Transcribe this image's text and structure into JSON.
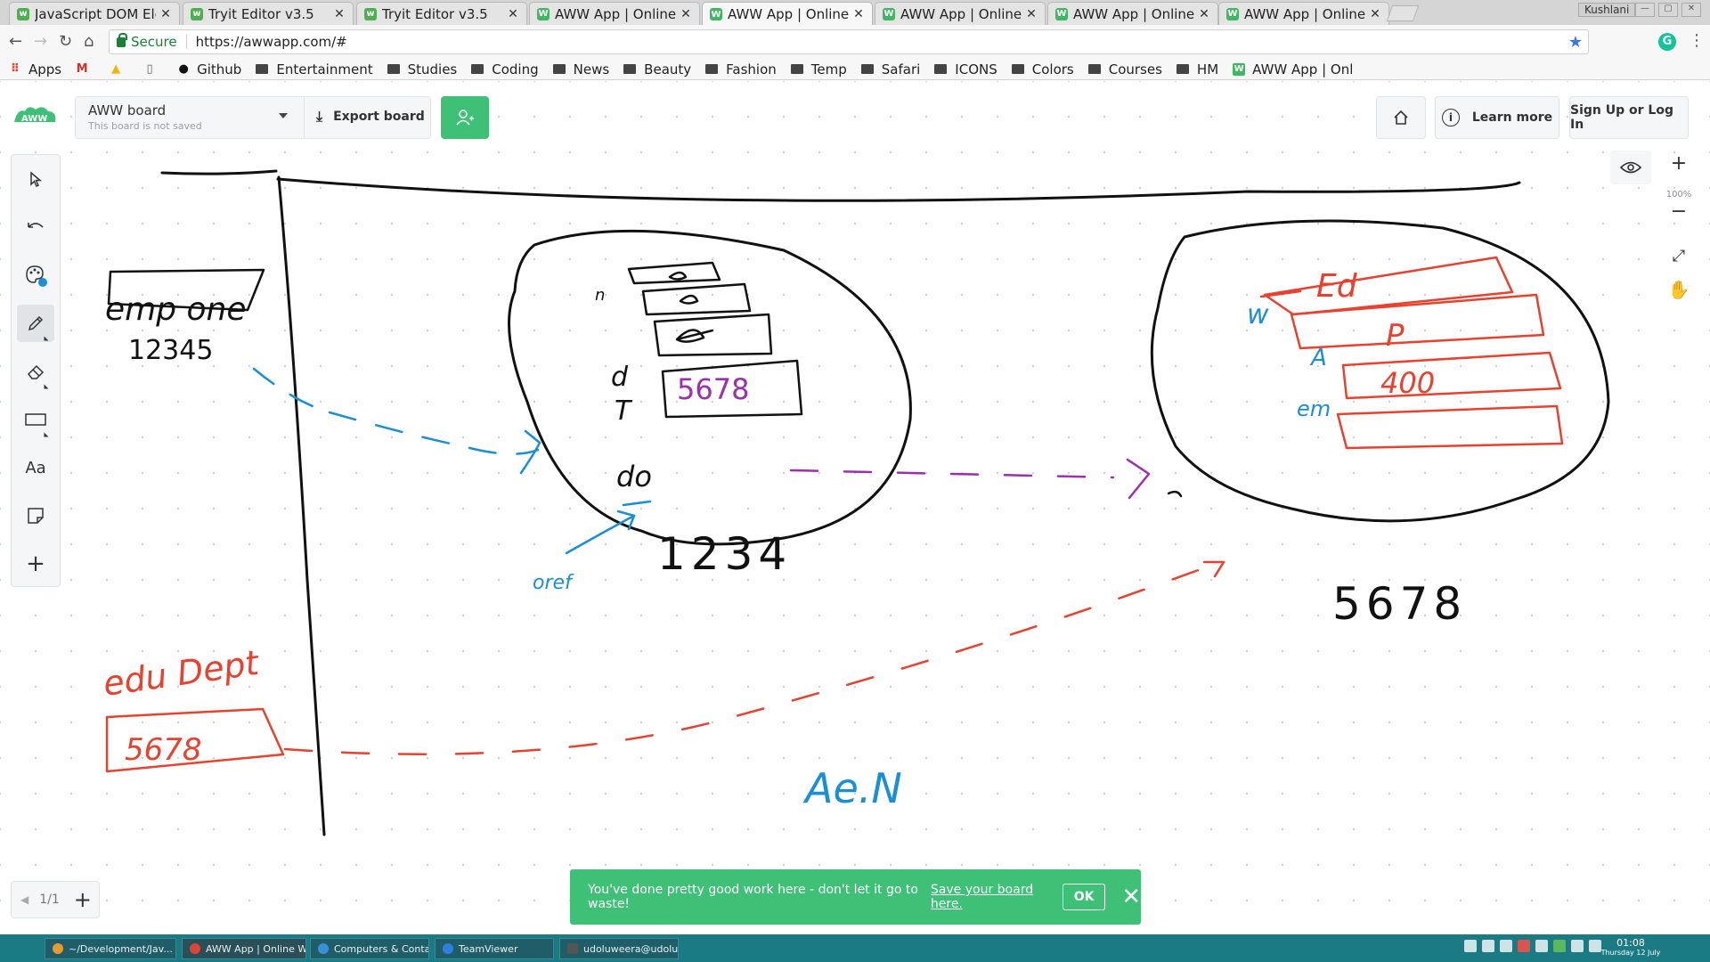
{
  "browser": {
    "tabs": [
      {
        "title": "JavaScript DOM Ele",
        "favicon": "w3-icon",
        "active": false
      },
      {
        "title": "Tryit Editor v3.5",
        "favicon": "w3-icon",
        "active": false
      },
      {
        "title": "Tryit Editor v3.5",
        "favicon": "w3-icon",
        "active": false
      },
      {
        "title": "AWW App | Online",
        "favicon": "aww-icon",
        "active": false
      },
      {
        "title": "AWW App | Online",
        "favicon": "aww-icon",
        "active": true
      },
      {
        "title": "AWW App | Online",
        "favicon": "aww-icon",
        "active": false
      },
      {
        "title": "AWW App | Online",
        "favicon": "aww-icon",
        "active": false
      },
      {
        "title": "AWW App | Online",
        "favicon": "aww-icon",
        "active": false
      }
    ],
    "window_user": "Kushlani",
    "secure_label": "Secure",
    "url": "https://awwapp.com/#",
    "bookmarks": [
      {
        "label": "Apps",
        "icon": "apps-grid-icon"
      },
      {
        "label": "",
        "icon": "gmail-icon"
      },
      {
        "label": "",
        "icon": "drive-icon"
      },
      {
        "label": "",
        "icon": "page-icon"
      },
      {
        "label": "Github",
        "icon": "github-icon"
      },
      {
        "label": "Entertainment",
        "icon": "folder-icon"
      },
      {
        "label": "Studies",
        "icon": "folder-icon"
      },
      {
        "label": "Coding",
        "icon": "folder-icon"
      },
      {
        "label": "News",
        "icon": "folder-icon"
      },
      {
        "label": "Beauty",
        "icon": "folder-icon"
      },
      {
        "label": "Fashion",
        "icon": "folder-icon"
      },
      {
        "label": "Temp",
        "icon": "folder-icon"
      },
      {
        "label": "Safari",
        "icon": "folder-icon"
      },
      {
        "label": "ICONS",
        "icon": "folder-icon"
      },
      {
        "label": "Colors",
        "icon": "folder-icon"
      },
      {
        "label": "Courses",
        "icon": "folder-icon"
      },
      {
        "label": "HM",
        "icon": "folder-icon"
      },
      {
        "label": "AWW App | Onl",
        "icon": "aww-icon"
      }
    ]
  },
  "app": {
    "logo_text": "AWW",
    "board_name": "AWW board",
    "board_status": "This board is not saved",
    "export_label": "Export board",
    "learn_more_label": "Learn more",
    "signup_label": "Sign Up or Log In",
    "zoom_level": "100%",
    "page_counter": "1/1",
    "tools": [
      "select-tool",
      "undo",
      "color-palette",
      "pencil",
      "eraser",
      "rectangle",
      "text",
      "sticky-note",
      "add"
    ],
    "text_tool_label": "Aa",
    "colors": {
      "accent": "#3ec076",
      "ink_black": "#111111",
      "ink_blue": "#1a8fd6",
      "ink_red": "#e8412e",
      "ink_purple": "#9b2fae"
    }
  },
  "canvas_text": {
    "emp_label": "emp one",
    "emp_box": "12345",
    "edu_label": "edu Dept",
    "edu_box": "5678",
    "obj1_box": "5678",
    "obj1_label": "1234",
    "obj2_label": "5678",
    "obj2_box1": "Ed",
    "obj2_box2": "P",
    "obj2_box3": "400",
    "obj2_letter1": "w",
    "obj2_letter2": "A",
    "obj2_letter3": "em",
    "props": [
      "n",
      "d",
      "T",
      "do"
    ],
    "oref_label": "oref",
    "note": "Ae.N"
  },
  "toast": {
    "message": "You've done pretty good work here - don't let it go to waste!",
    "link": "Save your board here.",
    "ok": "OK"
  },
  "taskbar": {
    "items": [
      "~/Development/Jav...",
      "AWW App | Online W...",
      "Computers & Conta...",
      "TeamViewer",
      "udoluweera@udolu..."
    ],
    "time": "01:08",
    "date": "Thursday 12 July"
  }
}
